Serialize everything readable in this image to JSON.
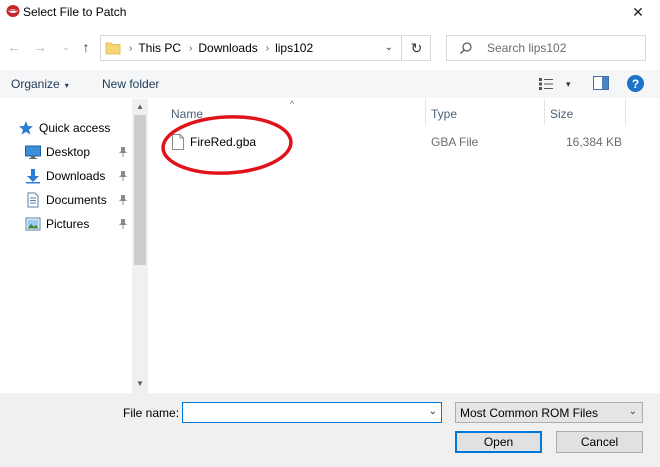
{
  "window": {
    "title": "Select File to Patch",
    "close_glyph": "✕",
    "app_icon": "lips-red-icon"
  },
  "nav": {
    "back_glyph": "←",
    "forward_glyph": "→",
    "recent_glyph": "⌄",
    "up_glyph": "↑",
    "breadcrumbs": [
      "This PC",
      "Downloads",
      "lips102"
    ],
    "crumb_sep": "›",
    "dropdown_glyph": "⌄",
    "refresh_glyph": "↻",
    "search_placeholder": "Search lips102"
  },
  "toolbar": {
    "organize": "Organize",
    "organize_caret": "▾",
    "new_folder": "New folder",
    "view_caret": "▾",
    "help": "?"
  },
  "navpane": {
    "quick_access": "Quick access",
    "items": [
      {
        "label": "Desktop",
        "icon": "desktop-icon",
        "pinned": true
      },
      {
        "label": "Downloads",
        "icon": "downloads-icon",
        "pinned": true
      },
      {
        "label": "Documents",
        "icon": "documents-icon",
        "pinned": true
      },
      {
        "label": "Pictures",
        "icon": "pictures-icon",
        "pinned": true
      }
    ]
  },
  "filelist": {
    "columns": {
      "name": "Name",
      "type": "Type",
      "size": "Size"
    },
    "sort_glyph": "^",
    "files": [
      {
        "name": "FireRed.gba",
        "type": "GBA File",
        "size": "16,384 KB"
      }
    ]
  },
  "bottom": {
    "file_name_label": "File name:",
    "file_name_value": "",
    "file_type": "Most Common ROM Files",
    "open": "Open",
    "cancel": "Cancel",
    "dropdown_glyph": "⌄"
  },
  "colors": {
    "accent": "#0078d7",
    "highlight_ellipse": "#e0121a",
    "toolbar_text": "#1e395b",
    "help_blue": "#1a72c9"
  }
}
